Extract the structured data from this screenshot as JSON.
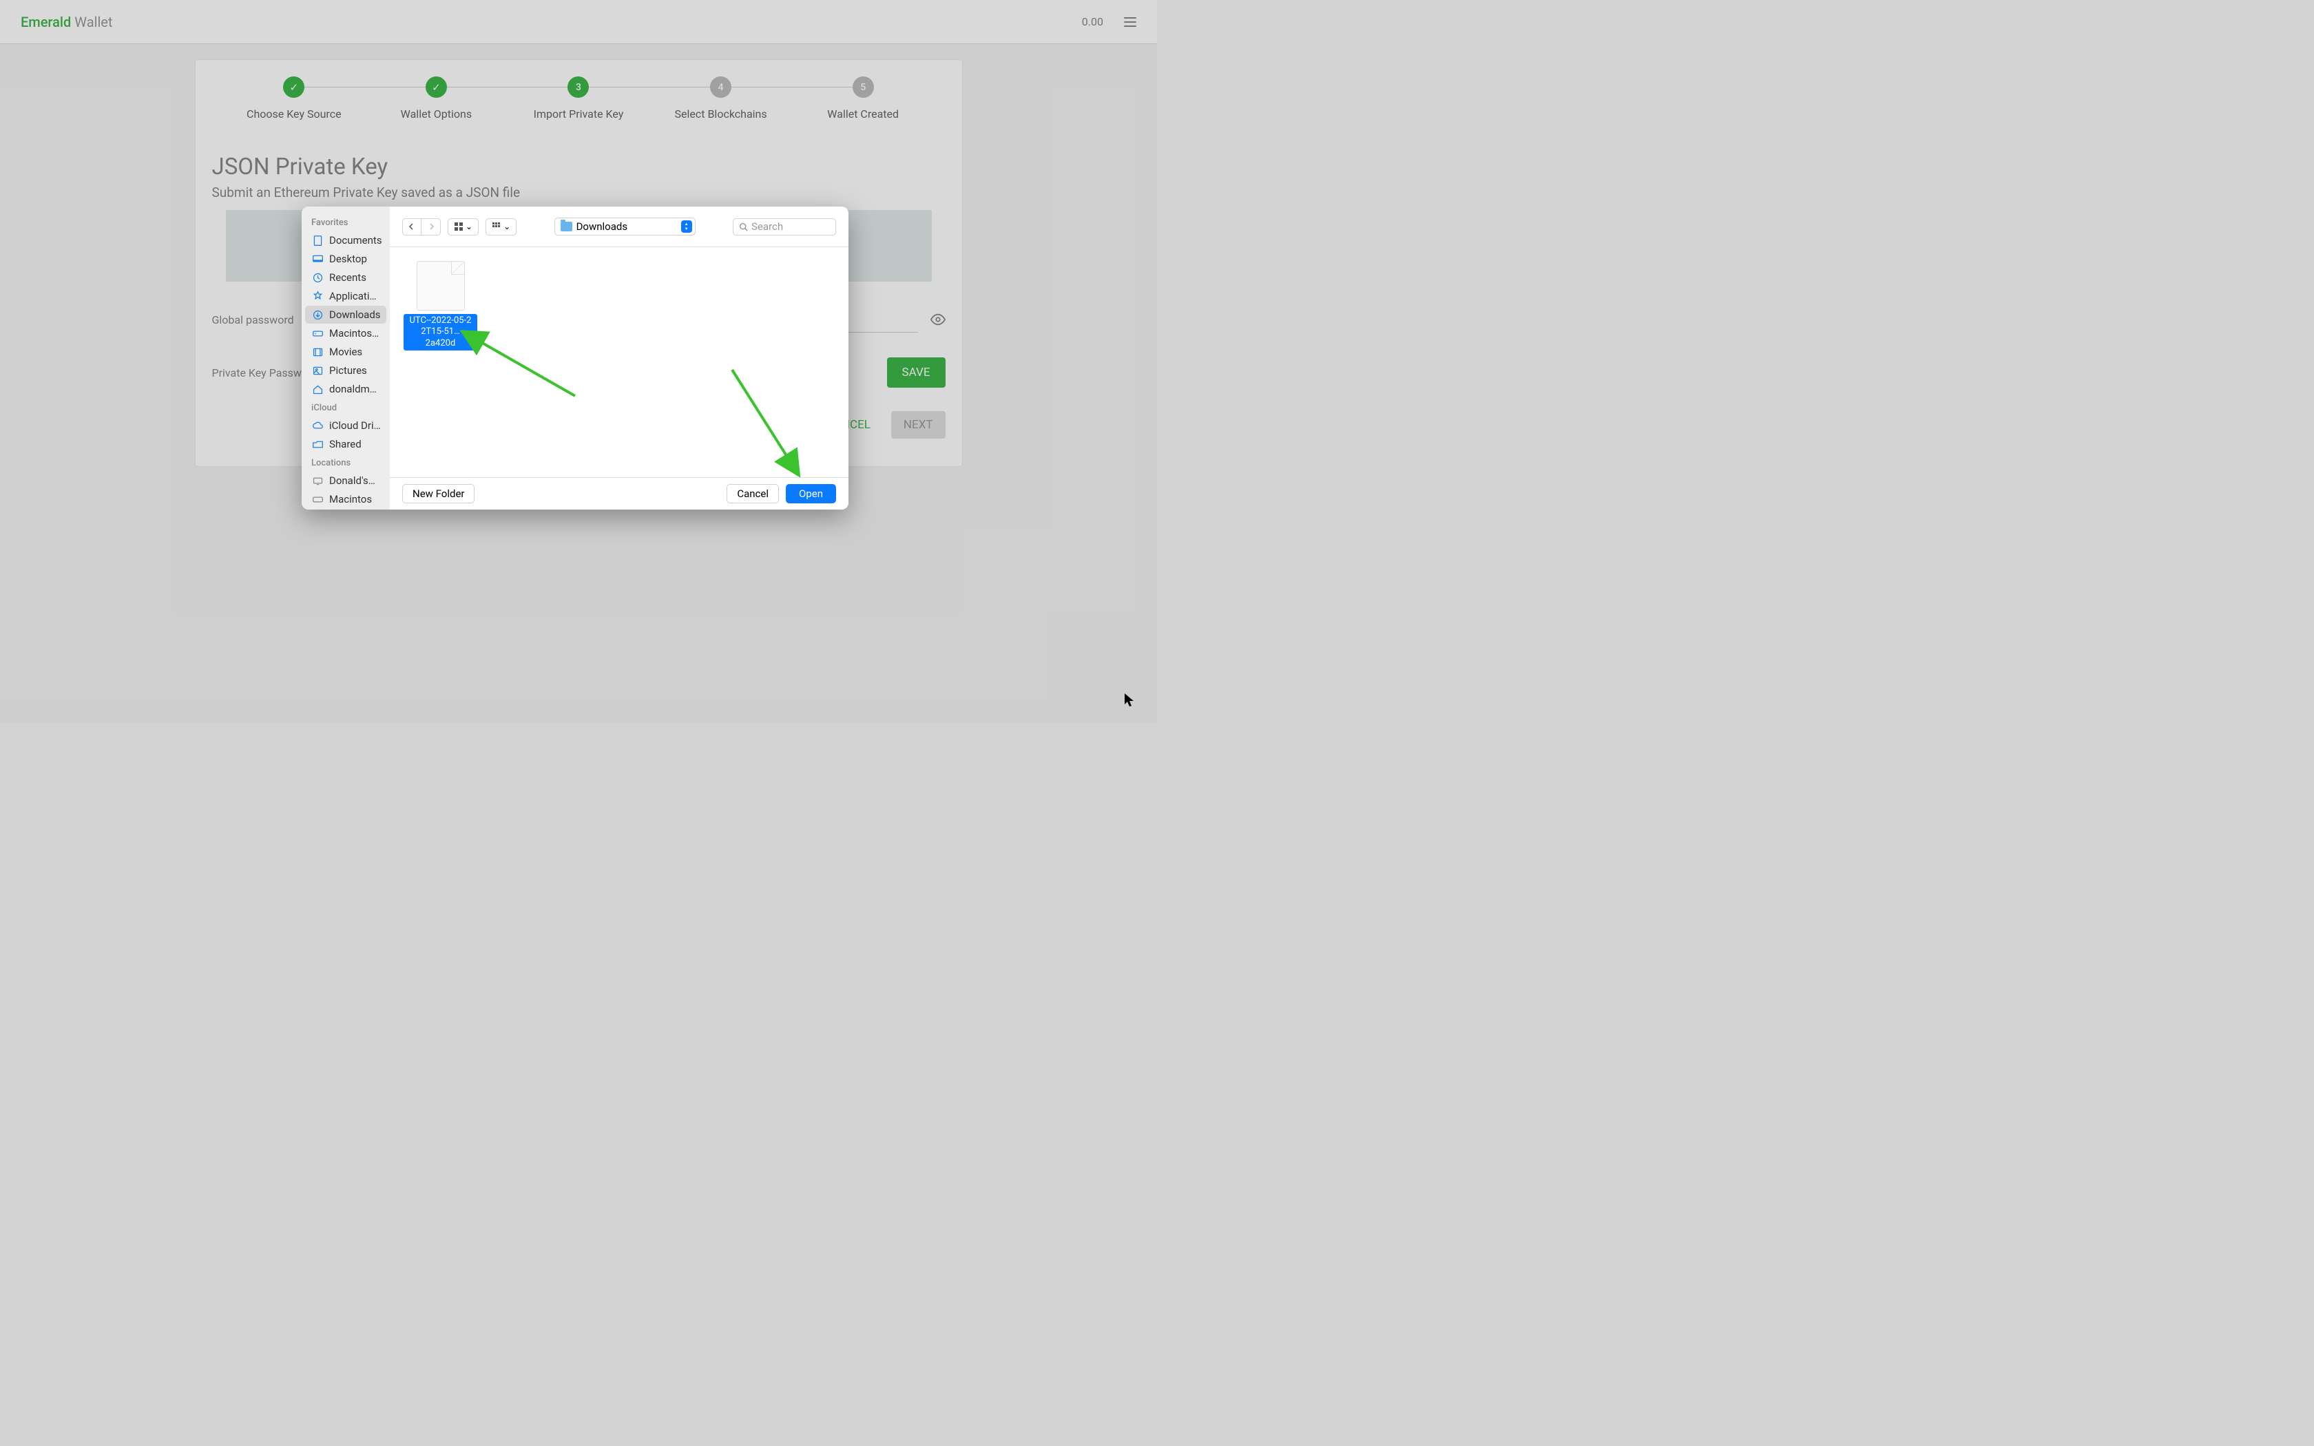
{
  "header": {
    "brand_a": "Emerald",
    "brand_b": "Wallet",
    "balance": "0.00"
  },
  "stepper": {
    "s1": {
      "label": "Choose Key Source"
    },
    "s2": {
      "label": "Wallet Options"
    },
    "s3": {
      "num": "3",
      "label": "Import Private Key"
    },
    "s4": {
      "num": "4",
      "label": "Select Blockchains"
    },
    "s5": {
      "num": "5",
      "label": "Wallet Created"
    }
  },
  "page": {
    "title": "JSON Private Key",
    "subtitle": "Submit an Ethereum Private Key saved as a JSON file",
    "global_password_label": "Global password",
    "private_key_password_label": "Private Key Password",
    "save_btn": "SAVE",
    "cancel_btn": "CANCEL",
    "next_btn": "NEXT"
  },
  "file_dialog": {
    "sidebar": {
      "favorites_title": "Favorites",
      "icloud_title": "iCloud",
      "locations_title": "Locations",
      "items": {
        "documents": "Documents",
        "desktop": "Desktop",
        "recents": "Recents",
        "applications": "Applicati…",
        "downloads": "Downloads",
        "macintosh": "Macintos…",
        "movies": "Movies",
        "pictures": "Pictures",
        "donaldm": "donaldm…",
        "icloud_drive": "iCloud Dri…",
        "shared": "Shared",
        "donalds": "Donald's…",
        "macintos2": "Macintos"
      }
    },
    "toolbar": {
      "location": "Downloads",
      "search_placeholder": "Search"
    },
    "file": {
      "line1": "UTC--2022-05-2",
      "line2": "2T15-51…2a420d"
    },
    "footer": {
      "new_folder": "New Folder",
      "cancel": "Cancel",
      "open": "Open"
    }
  }
}
